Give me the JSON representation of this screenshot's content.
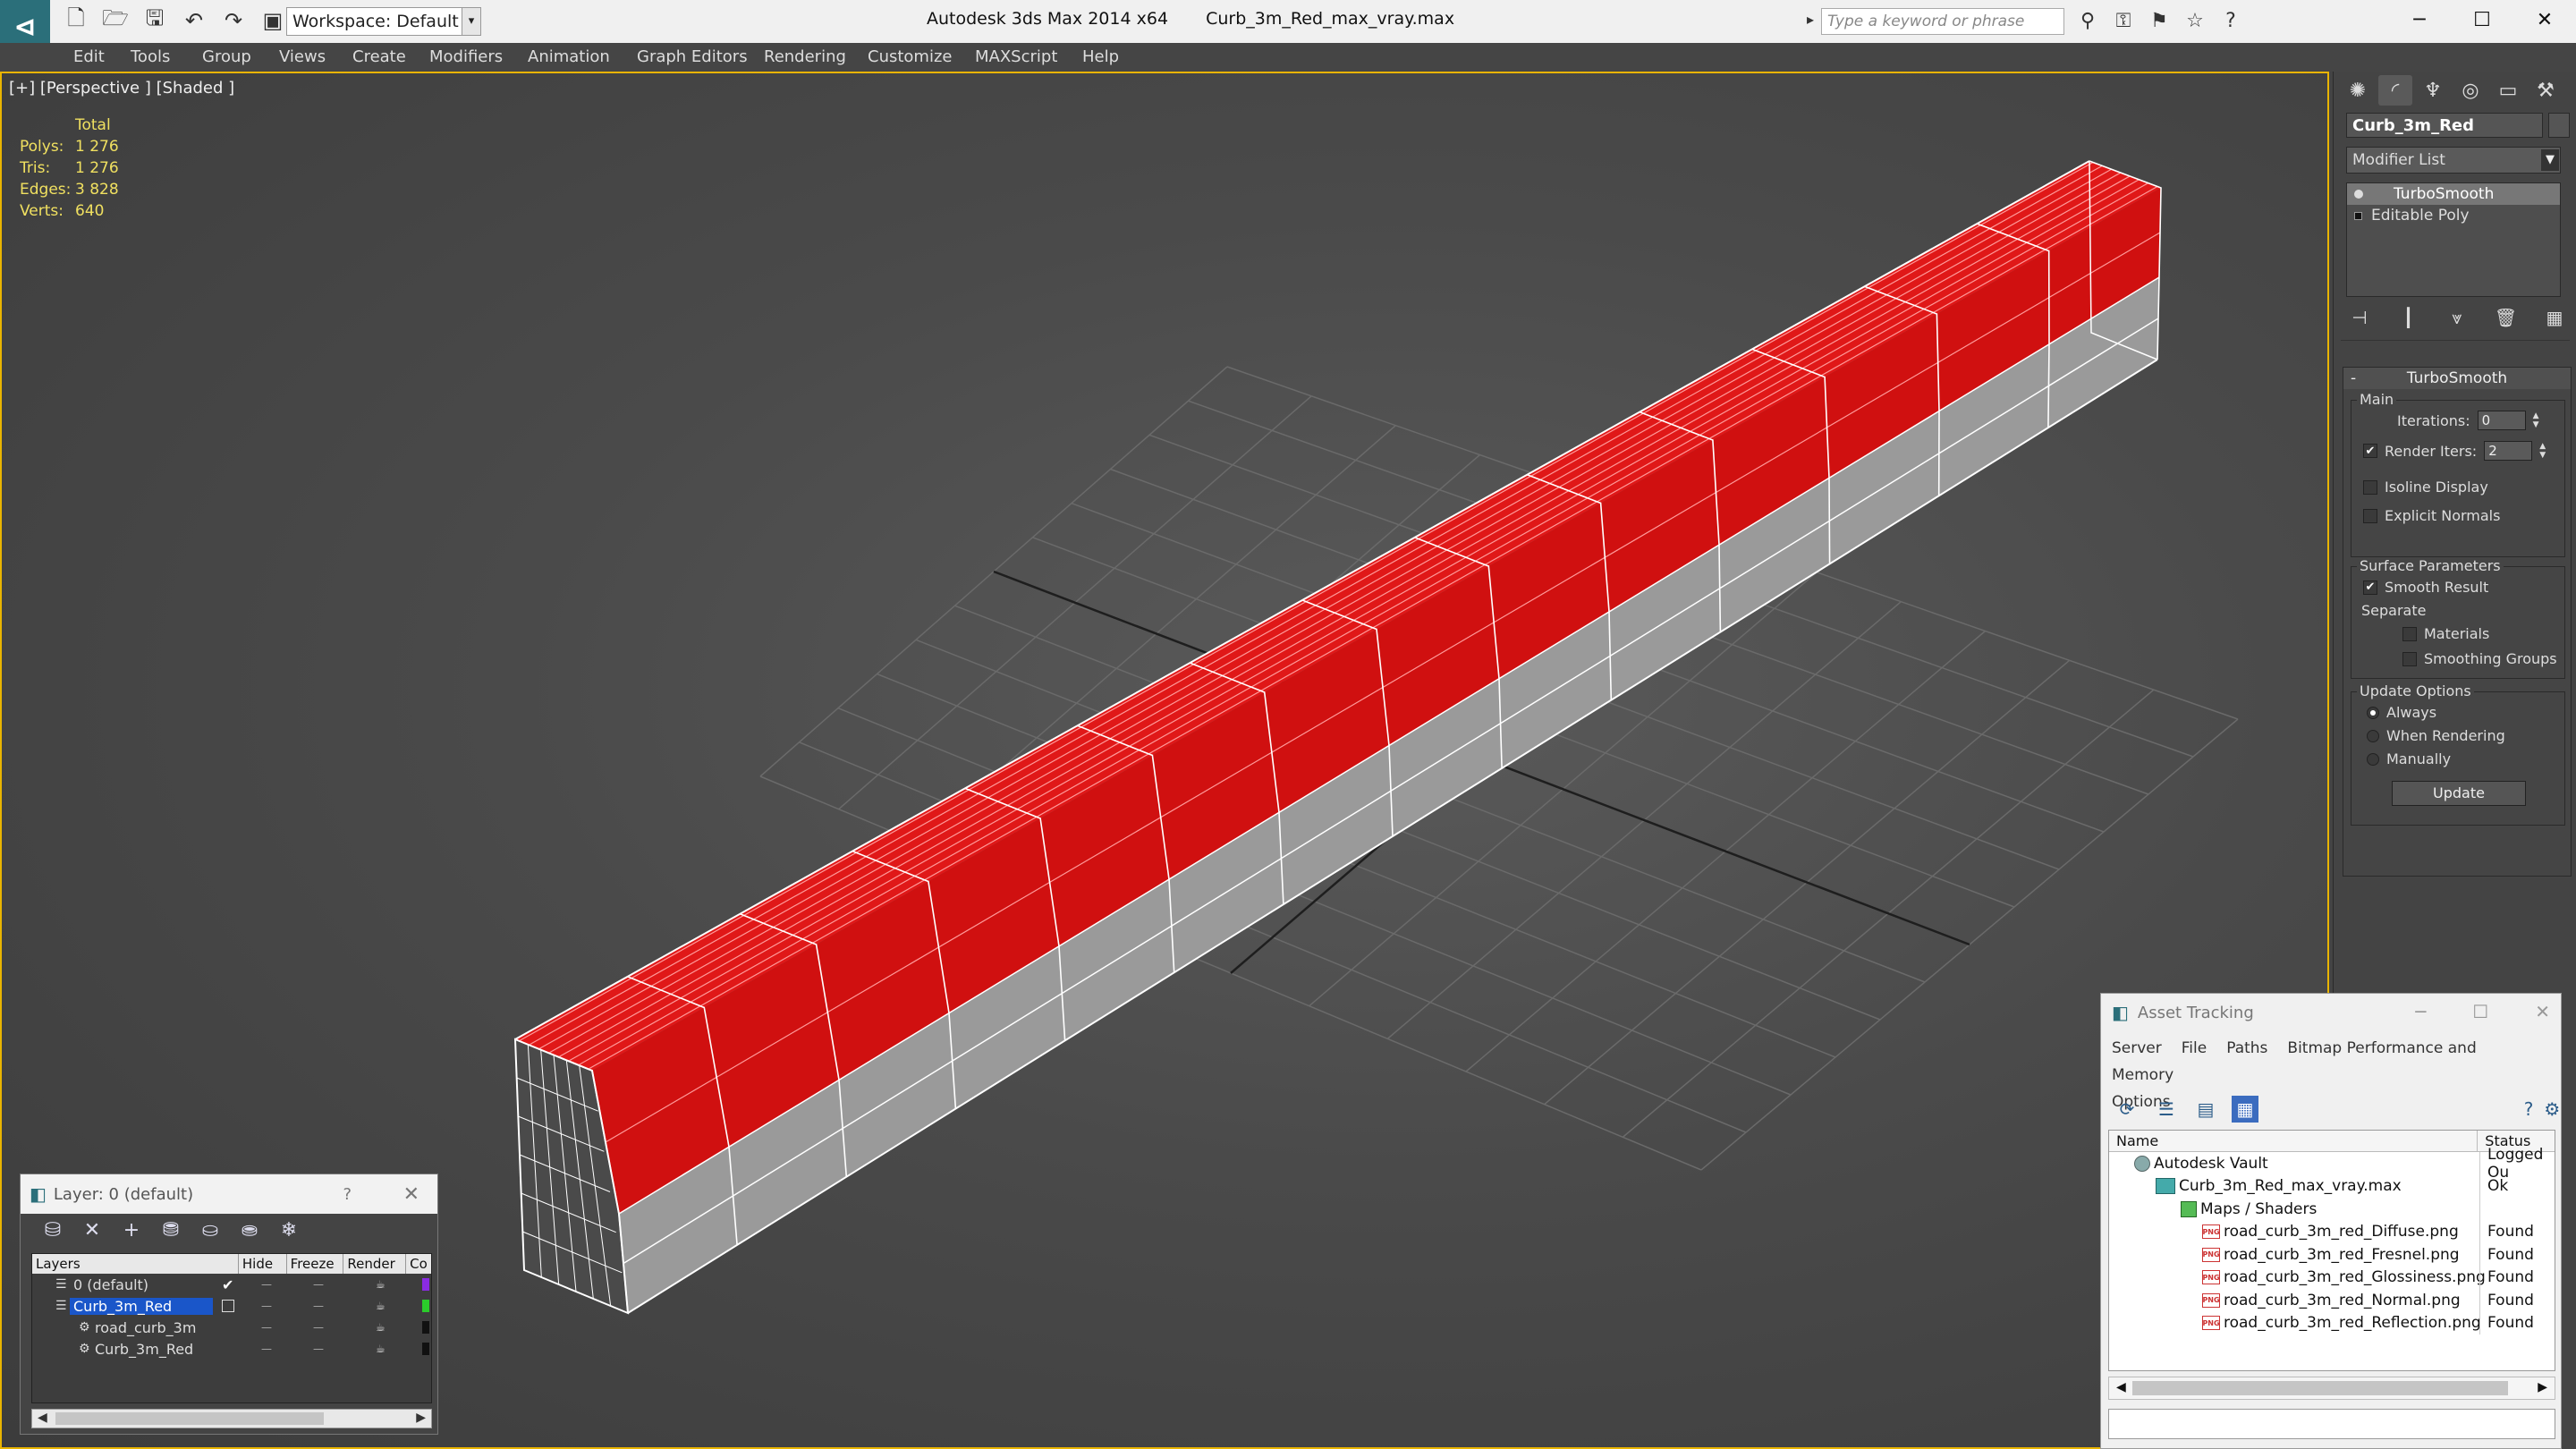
{
  "app": {
    "title": "Autodesk 3ds Max  2014 x64",
    "file": "Curb_3m_Red_max_vray.max",
    "workspace": "Workspace: Default",
    "search_placeholder": "Type a keyword or phrase"
  },
  "menu": [
    "Edit",
    "Tools",
    "Group",
    "Views",
    "Create",
    "Modifiers",
    "Animation",
    "Graph Editors",
    "Rendering",
    "Customize",
    "MAXScript",
    "Help"
  ],
  "viewport": {
    "label": "[+] [Perspective ] [Shaded ]",
    "stats_header": "Total",
    "stats": [
      {
        "k": "Polys:",
        "v": "1 276"
      },
      {
        "k": "Tris:",
        "v": "1 276"
      },
      {
        "k": "Edges:",
        "v": "3 828"
      },
      {
        "k": "Verts:",
        "v": "640"
      }
    ],
    "colors": {
      "red": "#d01010",
      "gray": "#9a9a9a",
      "wire": "#ffffff"
    }
  },
  "command_panel": {
    "object_name": "Curb_3m_Red",
    "modifier_list": "Modifier List",
    "stack": [
      {
        "label": "TurboSmooth",
        "selected": true
      },
      {
        "label": "Editable Poly",
        "selected": false
      }
    ],
    "rollout": {
      "title": "TurboSmooth",
      "main_label": "Main",
      "iterations_label": "Iterations:",
      "iterations": "0",
      "render_iters_label": "Render Iters:",
      "render_iters": "2",
      "isoline": "Isoline Display",
      "explicit": "Explicit Normals",
      "surface_label": "Surface Parameters",
      "smooth_result": "Smooth Result",
      "separate": "Separate",
      "materials": "Materials",
      "smoothing_groups": "Smoothing Groups",
      "update_label": "Update Options",
      "always": "Always",
      "when_rendering": "When Rendering",
      "manually": "Manually",
      "update_btn": "Update"
    }
  },
  "layer_window": {
    "title": "Layer: 0 (default)",
    "help": "?",
    "columns": [
      "Layers",
      "Hide",
      "Freeze",
      "Render",
      "Co"
    ],
    "rows": [
      {
        "name": "0 (default)",
        "color": "#8a2be2"
      },
      {
        "name": "Curb_3m_Red",
        "color": "#2bcc2b"
      },
      {
        "name": "road_curb_3m",
        "color": "#111111"
      },
      {
        "name": "Curb_3m_Red",
        "color": "#111111"
      }
    ]
  },
  "asset_tracking": {
    "title": "Asset Tracking",
    "menu": [
      "Server",
      "File",
      "Paths",
      "Bitmap Performance and Memory",
      "Options"
    ],
    "columns": [
      "Name",
      "Status"
    ],
    "rows": [
      {
        "name": "Autodesk Vault",
        "status": "Logged Ou"
      },
      {
        "name": "Curb_3m_Red_max_vray.max",
        "status": "Ok"
      },
      {
        "name": "Maps / Shaders",
        "status": ""
      },
      {
        "name": "road_curb_3m_red_Diffuse.png",
        "status": "Found"
      },
      {
        "name": "road_curb_3m_red_Fresnel.png",
        "status": "Found"
      },
      {
        "name": "road_curb_3m_red_Glossiness.png",
        "status": "Found"
      },
      {
        "name": "road_curb_3m_red_Normal.png",
        "status": "Found"
      },
      {
        "name": "road_curb_3m_red_Reflection.png",
        "status": "Found"
      }
    ]
  }
}
